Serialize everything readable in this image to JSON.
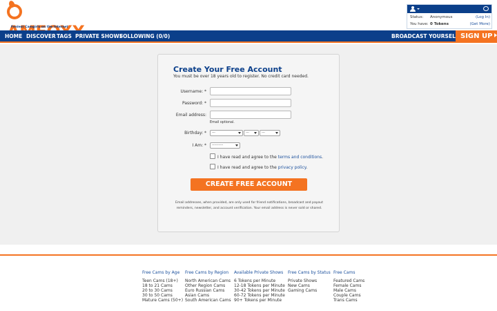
{
  "brand": {
    "logo_text": "AMFOXX",
    "tagline": "Fenlest Camgirls on the Internet",
    "accent_color": "#f47321",
    "nav_color": "#0b3f8a"
  },
  "status_box": {
    "status_label": "Status:",
    "status_value": "Anonymous",
    "login_link": "(Log In)",
    "tokens_label": "You have:",
    "tokens_value": "0 Tokens",
    "get_more_link": "(Get More)"
  },
  "nav": {
    "items": [
      "HOME",
      "DISCOVER",
      "TAGS",
      "PRIVATE SHOWS",
      "FOLLOWING (0/0)"
    ],
    "broadcast": "BROADCAST YOURSELF",
    "signup": "SIGN UP"
  },
  "form": {
    "title": "Create Your Free Account",
    "subtitle": "You must be over 18 years old to register. No credit card needed.",
    "username_label": "Username: *",
    "password_label": "Password: *",
    "email_label": "Email address:",
    "email_hint": "Email optional.",
    "birthday_label": "Birthday: *",
    "birthday_month": "---",
    "birthday_day": "---",
    "birthday_year": "---",
    "iam_label": "I Am: *",
    "iam_value": "----------",
    "terms_prefix": "I have read and agree to the ",
    "terms_link": "terms and conditions",
    "terms_suffix": ".",
    "privacy_prefix": "I have read and agree to the ",
    "privacy_link": "privacy policy",
    "privacy_suffix": ".",
    "submit": "CREATE FREE ACCOUNT",
    "disclaimer": "Email addresses, when provided, are only used for friend notifications, broadcast and payout reminders, newsletter, and account verification. Your email address is never sold or shared."
  },
  "footer": {
    "columns": [
      {
        "heading": "Free Cams by Age",
        "items": [
          "Teen Cams (18+)",
          "18 to 21 Cams",
          "20 to 30 Cams",
          "30 to 50 Cams",
          "Mature Cams (50+)"
        ]
      },
      {
        "heading": "Free Cams by Region",
        "items": [
          "North American Cams",
          "Other Region Cams",
          "Euro Russian Cams",
          "Asian Cams",
          "South American Cams"
        ]
      },
      {
        "heading": "Available Private Shows",
        "items": [
          "6 Tokens per Minute",
          "12-18 Tokens per Minute",
          "30-42 Tokens per Minute",
          "60-72 Tokens per Minute",
          "90+ Tokens per Minute"
        ]
      },
      {
        "heading": "Free Cams by Status",
        "items": [
          "Private Shows",
          "New Cams",
          "Gaming Cams"
        ]
      },
      {
        "heading": "Free Cams",
        "items": [
          "Featured Cams",
          "Female Cams",
          "Male Cams",
          "Couple Cams",
          "Trans Cams"
        ]
      }
    ]
  }
}
